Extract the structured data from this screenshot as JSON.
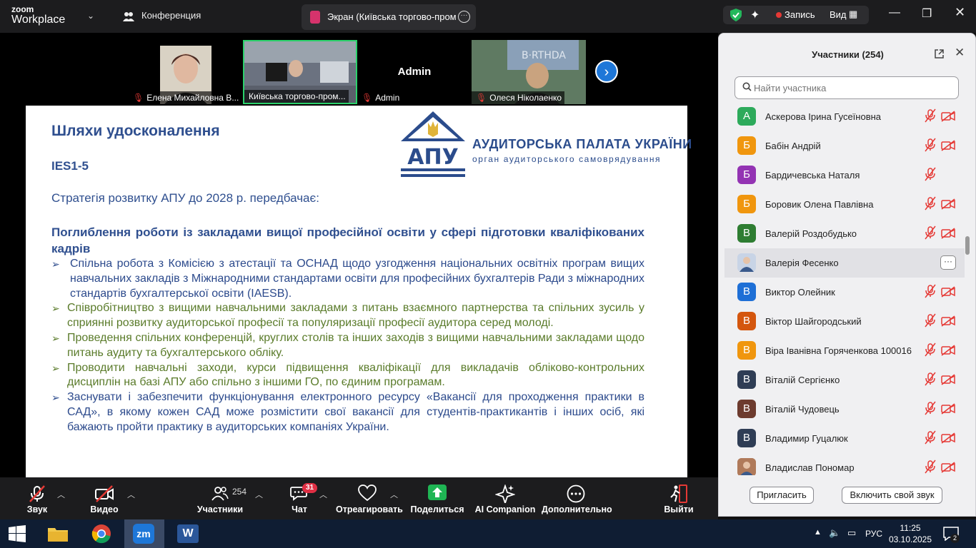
{
  "titlebar": {
    "logo_top": "zoom",
    "logo_bottom": "Workplace",
    "conference_label": "Конференция",
    "screen_tab_label": "Экран (Київська торгово-проми",
    "record_label": "Запись",
    "view_label": "Вид"
  },
  "video_strip": {
    "tiles": [
      {
        "name": "Елена Михайловна В..."
      },
      {
        "name": "Київська торгово-пром..."
      },
      {
        "name": "Admin",
        "center_label": "Admin"
      },
      {
        "name": "Олеся Ніколаенко"
      }
    ]
  },
  "slide": {
    "title": "Шляхи удосконалення",
    "subtitle": "IES1-5",
    "strategy": "Стратегія розвитку АПУ до 2028 р. передбачає:",
    "heading": "Поглиблення роботи із закладами вищої професійної освіти у сфері підготовки кваліфікованих кадрів",
    "logo_abbr": "АПУ",
    "logo_name": "АУДИТОРСЬКА ПАЛАТА УКРАЇНИ",
    "logo_tagline": "орган аудиторського самоврядування",
    "bullets": [
      "Спільна робота з Комісією з атестації та ОСНАД щодо узгодження національних освітніх програм вищих навчальних закладів з Міжнародними стандартами освіти для професійних бухгалтерів Ради з міжнародних стандартів бухгалтерської освіти (IAESB).",
      "Співробітництво з вищими навчальними закладами з питань взаємного партнерства та спільних зусиль у сприянні розвитку аудиторської професії та популяризації професії аудитора серед молоді.",
      "Проведення спільних конференцій, круглих столів та інших заходів з вищими навчальними закладами щодо питань аудиту та бухгалтерського обліку.",
      "Проводити навчальні заходи, курси підвищення кваліфікації для викладачів обліково-контрольних дисциплін на базі АПУ або спільно з іншими ГО, по єдиним програмам.",
      "Заснувати і забезпечити функціонування електронного ресурсу «Вакансії для проходження практики в САД», в якому кожен САД може розмістити свої вакансії для студентів-практикантів і інших осіб, які бажають пройти практику в аудиторських компаніях України."
    ]
  },
  "participants": {
    "title": "Участники (254)",
    "search_placeholder": "Найти участника",
    "list": [
      {
        "initial": "А",
        "name": "Аскерова Ірина Гусеїновна",
        "color": "#2daa5b",
        "cam": true
      },
      {
        "initial": "Б",
        "name": "Бабін Андрій",
        "color": "#f0960e",
        "cam": true
      },
      {
        "initial": "Б",
        "name": "Бардичевська Наталя",
        "color": "#9333b3",
        "cam": false
      },
      {
        "initial": "Б",
        "name": "Боровик Олена Павлівна",
        "color": "#f0960e",
        "cam": true
      },
      {
        "initial": "В",
        "name": "Валерій Роздобудько",
        "color": "#2e7d32",
        "cam": true
      },
      {
        "initial": "",
        "name": "Валерія Фесенко",
        "color": "#c8d4e6",
        "cam": false,
        "highlight": true,
        "photo": true
      },
      {
        "initial": "В",
        "name": "Виктор Олейник",
        "color": "#1e6fd6",
        "cam": true
      },
      {
        "initial": "В",
        "name": "Віктор Шайгородський",
        "color": "#d4560e",
        "cam": true
      },
      {
        "initial": "В",
        "name": "Віра Іванівна Горяченкова 100016",
        "color": "#f0960e",
        "cam": true
      },
      {
        "initial": "В",
        "name": "Віталій Сергієнко",
        "color": "#2f3d55",
        "cam": true
      },
      {
        "initial": "В",
        "name": "Віталій Чудовець",
        "color": "#6d3b2e",
        "cam": true
      },
      {
        "initial": "В",
        "name": "Владимир Гуцалюк",
        "color": "#2f3d55",
        "cam": true
      },
      {
        "initial": "",
        "name": "Владислав Пономар",
        "color": "#b07a5a",
        "cam": true,
        "photo": true
      }
    ],
    "invite_label": "Пригласить",
    "unmute_self_label": "Включить свой звук"
  },
  "toolbar": {
    "audio": "Звук",
    "video": "Видео",
    "participants": "Участники",
    "participants_count": "254",
    "chat": "Чат",
    "chat_badge": "31",
    "react": "Отреагировать",
    "share": "Поделиться",
    "ai": "AI Companion",
    "more": "Дополнительно",
    "leave": "Выйти"
  },
  "taskbar": {
    "lang": "РУС",
    "time": "11:25",
    "date": "03.10.2025",
    "notifications": "2"
  },
  "colors": {
    "zoom_blue": "#1e77d8",
    "share_green": "#1fb554",
    "slide_blue": "#2f4f8f",
    "slide_green": "#5a7b2a",
    "mute_red": "#e53935"
  }
}
